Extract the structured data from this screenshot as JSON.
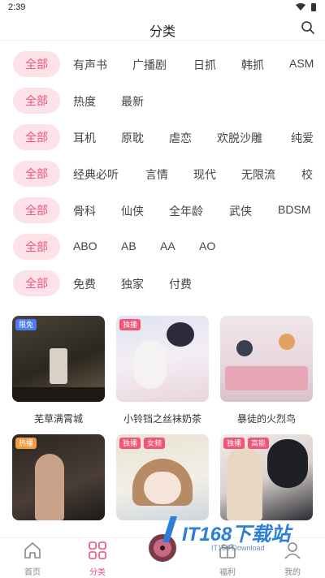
{
  "status": {
    "time": "2:39"
  },
  "header": {
    "title": "分类"
  },
  "filters": [
    {
      "all": "全部",
      "options": [
        "有声书",
        "广播剧",
        "日抓",
        "韩抓",
        "ASM"
      ]
    },
    {
      "all": "全部",
      "options": [
        "热度",
        "最新"
      ]
    },
    {
      "all": "全部",
      "options": [
        "耳机",
        "原耽",
        "虐恋",
        "欢脱沙雕",
        "纯爱"
      ]
    },
    {
      "all": "全部",
      "options": [
        "经典必听",
        "言情",
        "现代",
        "无限流",
        "校"
      ]
    },
    {
      "all": "全部",
      "options": [
        "骨科",
        "仙侠",
        "全年龄",
        "武侠",
        "BDSM"
      ]
    },
    {
      "all": "全部",
      "options": [
        "ABO",
        "AB",
        "AA",
        "AO"
      ]
    },
    {
      "all": "全部",
      "options": [
        "免费",
        "独家",
        "付费"
      ]
    }
  ],
  "cards": [
    {
      "title": "芜草满霄城",
      "badges": [
        "限免"
      ]
    },
    {
      "title": "小铃铛之丝袜奶茶",
      "badges": [
        "独播"
      ]
    },
    {
      "title": "暴徒的火烈鸟",
      "badges": []
    },
    {
      "title": "",
      "badges": [
        "热播"
      ]
    },
    {
      "title": "",
      "badges": [
        "独播",
        "女频"
      ]
    },
    {
      "title": "",
      "badges": [
        "独播",
        "高能"
      ]
    }
  ],
  "tabs": [
    {
      "label": "首页",
      "icon": "home-icon"
    },
    {
      "label": "分类",
      "icon": "category-icon"
    },
    {
      "label": "",
      "icon": "player-icon"
    },
    {
      "label": "福利",
      "icon": "gift-icon"
    },
    {
      "label": "我的",
      "icon": "profile-icon"
    }
  ],
  "watermark": {
    "text": "IT168下载站",
    "sub": "IT168 Download"
  },
  "colors": {
    "accent": "#f25377",
    "chip_bg": "#fde3e9",
    "badge_blue": "#4a7cf6"
  }
}
